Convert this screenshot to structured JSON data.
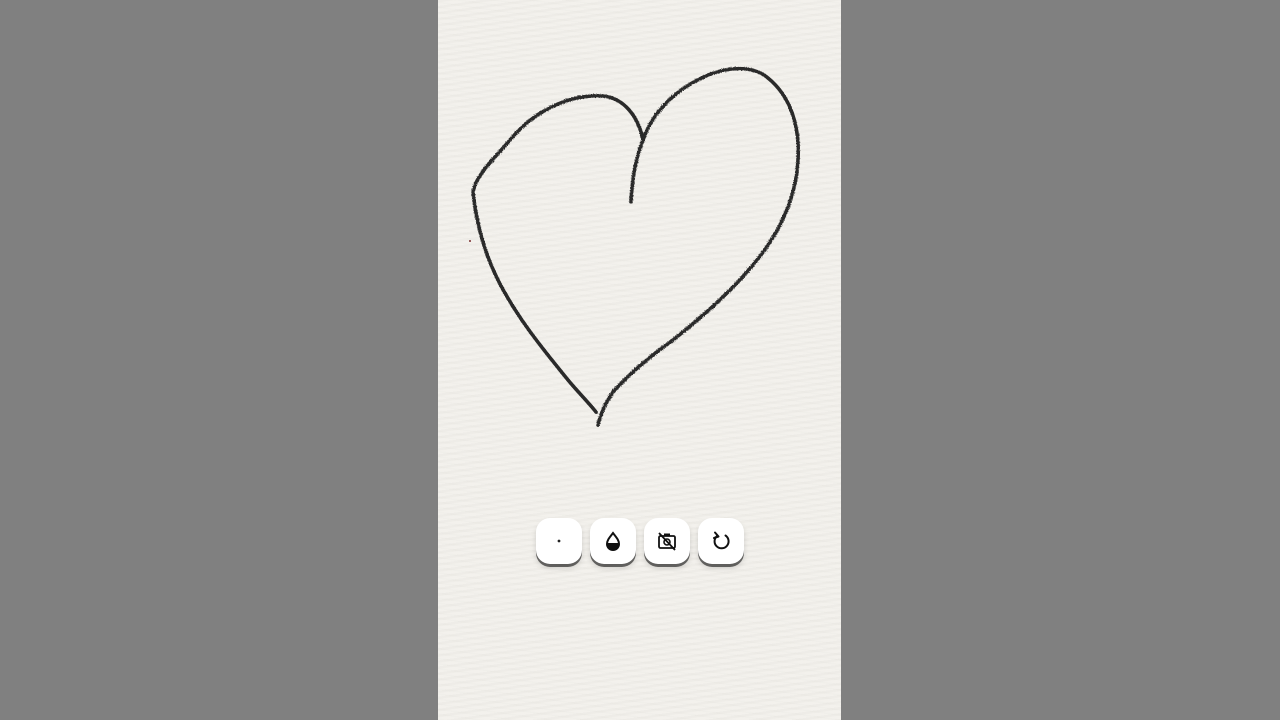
{
  "canvas": {
    "background_color": "#808080",
    "paper_color": "#f3f1ec",
    "ink_color": "#2a2a2a",
    "drawing_subject": "heart-sketch"
  },
  "toolbar": {
    "buttons": [
      {
        "id": "brush-size",
        "icon": "brush-size-dot-icon"
      },
      {
        "id": "ink-level",
        "icon": "ink-drop-icon"
      },
      {
        "id": "camera-off",
        "icon": "camera-off-icon"
      },
      {
        "id": "undo",
        "icon": "undo-icon"
      }
    ]
  }
}
